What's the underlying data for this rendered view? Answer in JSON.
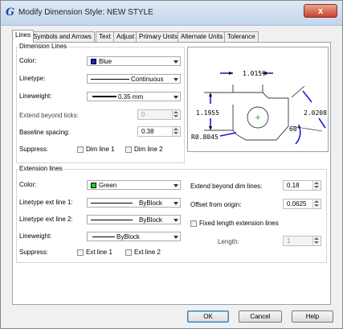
{
  "window": {
    "title": "Modify Dimension Style: NEW STYLE",
    "close_glyph": "x"
  },
  "tabs": [
    "Lines",
    "Symbols and Arrows",
    "Text",
    "Adjust",
    "Primary Units",
    "Alternate Units",
    "Tolerance"
  ],
  "dimension_lines": {
    "group_label": "Dimension Lines",
    "color_label": "Color:",
    "color_value": "Blue",
    "color_hex": "#1f1fd0",
    "linetype_label": "Linetype:",
    "linetype_value": "Continuous",
    "lineweight_label": "Lineweight:",
    "lineweight_value": "0.35 mm",
    "extend_label": "Extend beyond ticks:",
    "extend_value": "0",
    "baseline_label": "Baseline spacing:",
    "baseline_value": "0.38",
    "suppress_label": "Suppress:",
    "suppress_1": "Dim line 1",
    "suppress_2": "Dim line 2"
  },
  "preview": {
    "dim_top": "1.0159",
    "dim_left": "1.1955",
    "dim_right": "2.0208",
    "angle": "60°",
    "radius": "R0.8045"
  },
  "extension_lines": {
    "group_label": "Extension lines",
    "color_label": "Color:",
    "color_value": "Green",
    "color_hex": "#1fd01f",
    "linetype1_label": "Linetype ext line 1:",
    "linetype1_value": "ByBlock",
    "linetype2_label": "Linetype ext line 2:",
    "linetype2_value": "ByBlock",
    "lineweight_label": "Lineweight:",
    "lineweight_value": "ByBlock",
    "suppress_label": "Suppress:",
    "suppress_1": "Ext line 1",
    "suppress_2": "Ext line 2",
    "extend_label": "Extend beyond dim lines:",
    "extend_value": "0.18",
    "offset_label": "Offset from origin:",
    "offset_value": "0.0625",
    "fixed_label": "Fixed length extension lines",
    "length_label": "Length:",
    "length_value": "1"
  },
  "buttons": {
    "ok": "OK",
    "cancel": "Cancel",
    "help": "Help"
  }
}
